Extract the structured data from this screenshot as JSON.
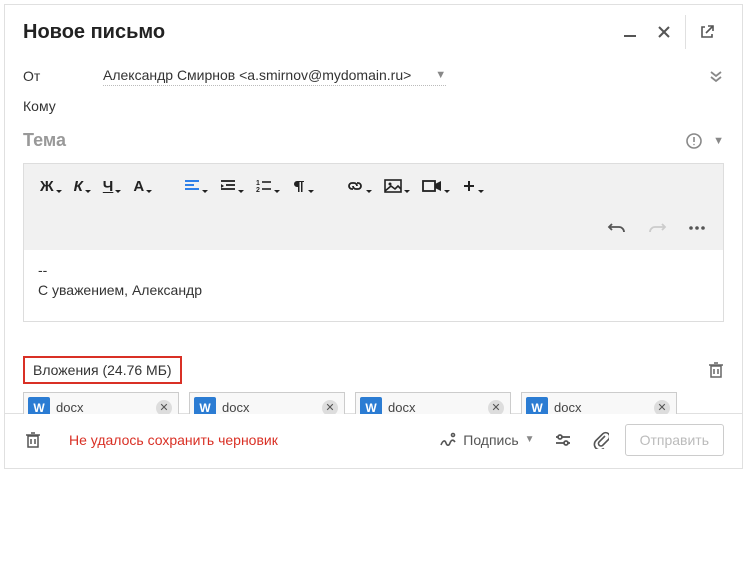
{
  "header": {
    "title": "Новое письмо"
  },
  "from": {
    "label": "От",
    "value": "Александр Смирнов <a.smirnov@mydomain.ru>"
  },
  "to": {
    "label": "Кому"
  },
  "subject": {
    "placeholder": "Тема"
  },
  "body": {
    "separator": "--",
    "signature": "С уважением, Александр"
  },
  "attachments": {
    "label": "Вложения (24.76 МБ)",
    "items": [
      {
        "icon": "W",
        "name": "docx"
      },
      {
        "icon": "W",
        "name": "docx"
      },
      {
        "icon": "W",
        "name": "docx"
      },
      {
        "icon": "W",
        "name": "docx"
      }
    ]
  },
  "footer": {
    "error": "Не удалось сохранить черновик",
    "signature_label": "Подпись",
    "send_label": "Отправить"
  },
  "toolbar": {
    "bold": "Ж",
    "italic": "К",
    "underline": "Ч",
    "font": "A"
  }
}
